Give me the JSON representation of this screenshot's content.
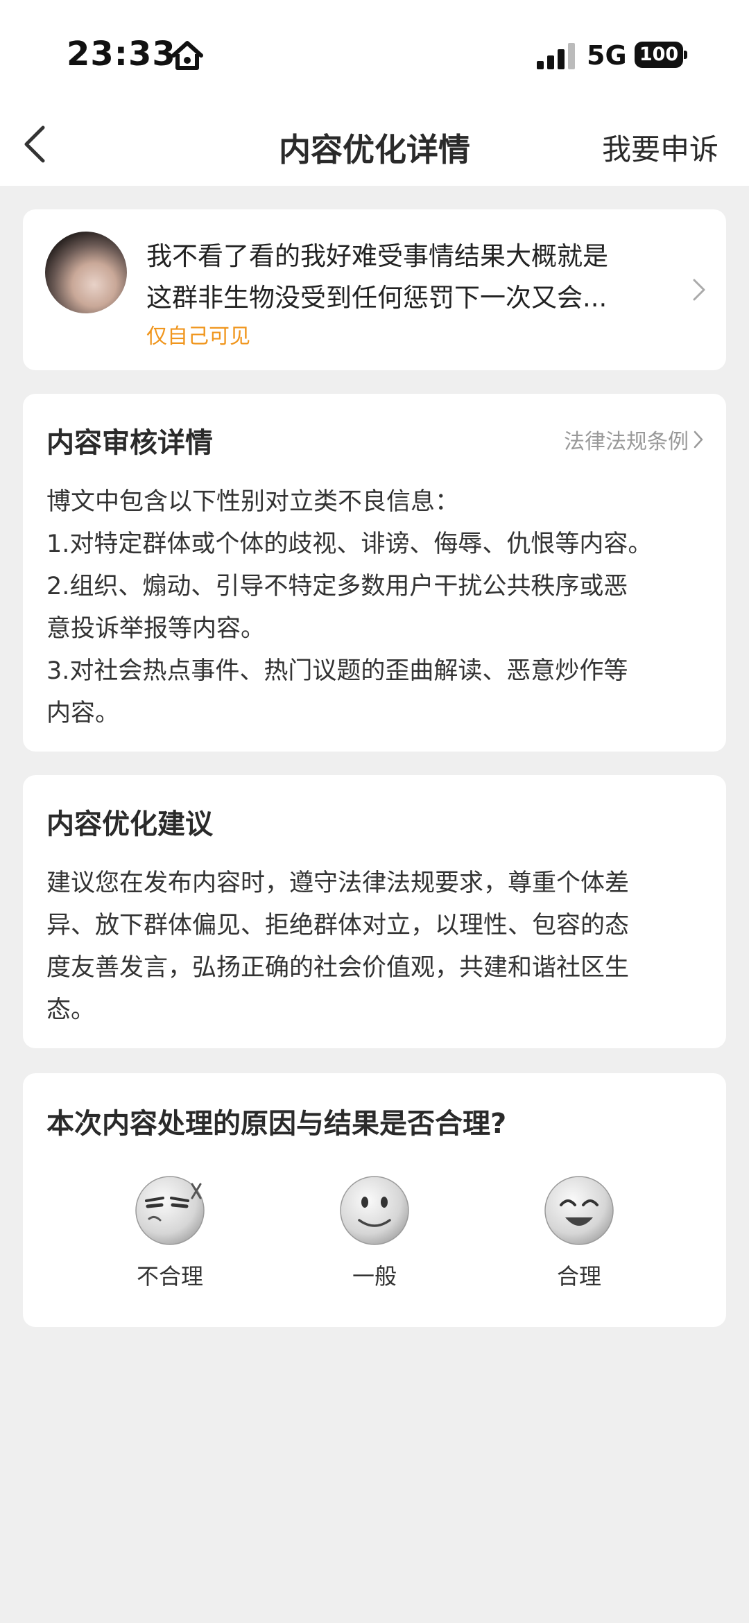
{
  "status_bar": {
    "time": "23:33",
    "network": "5G",
    "battery": "100"
  },
  "nav": {
    "title": "内容优化详情",
    "appeal_label": "我要申诉"
  },
  "post": {
    "text_lines": [
      "我不看了看的我好难受事情结果大概就是",
      "这群非生物没受到任何惩罚下一次又会..."
    ],
    "visibility": "仅自己可见"
  },
  "review": {
    "heading": "内容审核详情",
    "law_link": "法律法规条例",
    "lines": [
      "博文中包含以下性别对立类不良信息：",
      "1.对特定群体或个体的歧视、诽谤、侮辱、仇恨等内容。",
      "2.组织、煽动、引导不特定多数用户干扰公共秩序或恶",
      "意投诉举报等内容。",
      "3.对社会热点事件、热门议题的歪曲解读、恶意炒作等",
      "内容。"
    ]
  },
  "suggestion": {
    "heading": "内容优化建议",
    "lines": [
      "建议您在发布内容时，遵守法律法规要求，尊重个体差",
      "异、放下群体偏见、拒绝群体对立，以理性、包容的态",
      "度友善发言，弘扬正确的社会价值观，共建和谐社区生",
      "态。"
    ]
  },
  "feedback": {
    "question": "本次内容处理的原因与结果是否合理?",
    "options": [
      {
        "label": "不合理",
        "icon": "angry-face-icon"
      },
      {
        "label": "一般",
        "icon": "neutral-face-icon"
      },
      {
        "label": "合理",
        "icon": "happy-face-icon"
      }
    ]
  },
  "colors": {
    "accent_orange": "#f0961e",
    "background": "#efefef",
    "card": "#ffffff"
  }
}
